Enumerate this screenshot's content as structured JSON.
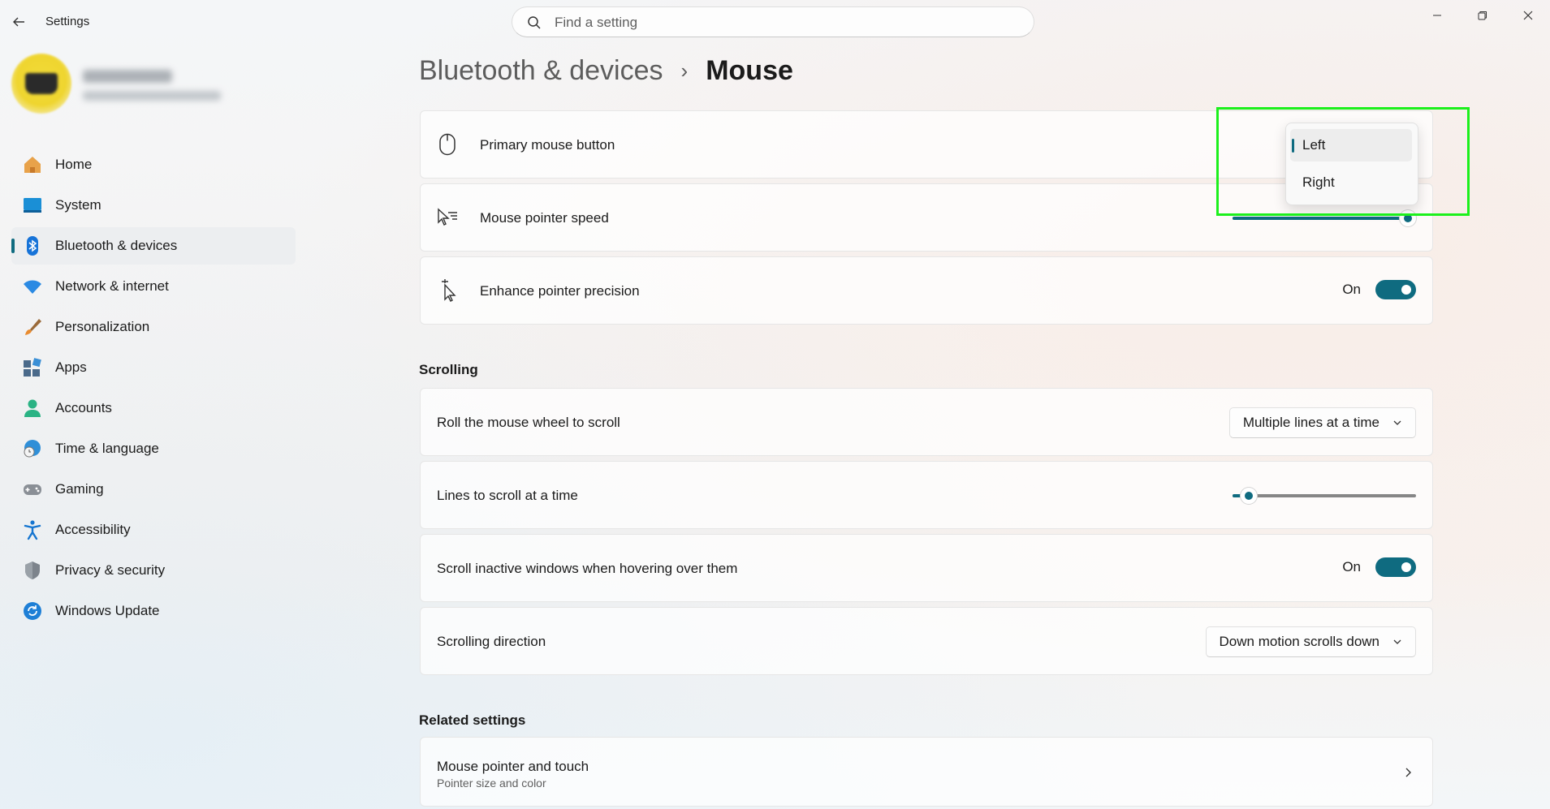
{
  "window": {
    "app_title": "Settings"
  },
  "search": {
    "placeholder": "Find a setting"
  },
  "sidebar": {
    "items": [
      {
        "label": "Home",
        "icon": "home-icon"
      },
      {
        "label": "System",
        "icon": "system-icon"
      },
      {
        "label": "Bluetooth & devices",
        "icon": "bluetooth-icon",
        "active": true
      },
      {
        "label": "Network & internet",
        "icon": "wifi-icon"
      },
      {
        "label": "Personalization",
        "icon": "brush-icon"
      },
      {
        "label": "Apps",
        "icon": "apps-icon"
      },
      {
        "label": "Accounts",
        "icon": "person-icon"
      },
      {
        "label": "Time & language",
        "icon": "globe-clock-icon"
      },
      {
        "label": "Gaming",
        "icon": "gamepad-icon"
      },
      {
        "label": "Accessibility",
        "icon": "accessibility-icon"
      },
      {
        "label": "Privacy & security",
        "icon": "shield-icon"
      },
      {
        "label": "Windows Update",
        "icon": "refresh-icon"
      }
    ]
  },
  "breadcrumb": {
    "parent": "Bluetooth & devices",
    "separator": "›",
    "current": "Mouse"
  },
  "mouse": {
    "primary_button": {
      "label": "Primary mouse button",
      "icon": "mouse-icon"
    },
    "pointer_speed": {
      "label": "Mouse pointer speed",
      "icon": "pointer-speed-icon",
      "level": 1.0
    },
    "precision": {
      "label": "Enhance pointer precision",
      "icon": "pointer-precision-icon",
      "state": "On"
    }
  },
  "popup": {
    "options": [
      "Left",
      "Right"
    ],
    "selected": "Left"
  },
  "scrolling": {
    "title": "Scrolling",
    "roll": {
      "label": "Roll the mouse wheel to scroll",
      "value": "Multiple lines at a time"
    },
    "lines": {
      "label": "Lines to scroll at a time",
      "level": 0.05
    },
    "inactive": {
      "label": "Scroll inactive windows when hovering over them",
      "state": "On"
    },
    "direction": {
      "label": "Scrolling direction",
      "value": "Down motion scrolls down"
    }
  },
  "related": {
    "title": "Related settings",
    "pointer_touch": {
      "label": "Mouse pointer and touch",
      "sublabel": "Pointer size and color"
    }
  },
  "colors": {
    "accent": "#0f6b80",
    "highlight": "#1cf01c"
  }
}
